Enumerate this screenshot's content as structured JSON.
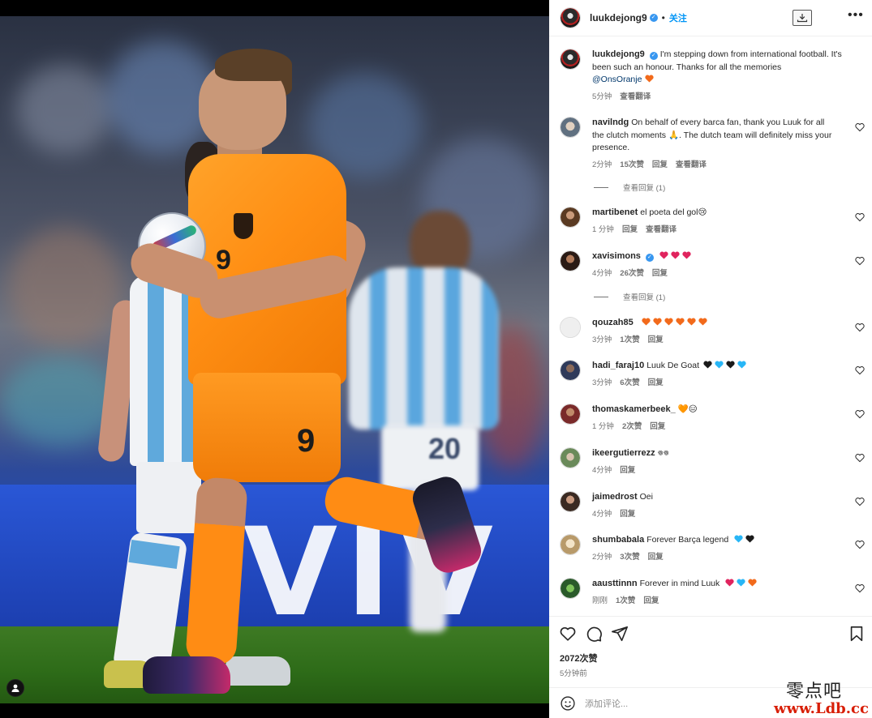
{
  "post": {
    "author": "luukdejong9",
    "follow_label": "关注",
    "dot": "•",
    "caption": "I'm stepping down from international football. It's been such an honour. Thanks for all the memories",
    "caption_mention": "@OnsOranje",
    "caption_time": "5分钟",
    "caption_translate": "查看翻译",
    "likes": "2072次赞",
    "posted": "5分钟前",
    "add_comment_placeholder": "添加评论..."
  },
  "photo": {
    "shirt_number": "9",
    "shorts_number": "9",
    "banner_text": "VIV",
    "bg_number": "20"
  },
  "comments": [
    {
      "user": "navilndg",
      "text": "On behalf of every barca fan, thank you Luuk for all the clutch moments 🙏. The dutch team will definitely miss your presence.",
      "time": "2分钟",
      "likes": "15次赞",
      "reply": "回复",
      "translate": "查看翻译",
      "view_replies": "查看回复 (1)"
    },
    {
      "user": "martibenet",
      "text": "el poeta del gol😢",
      "time": "1 分钟",
      "reply": "回复",
      "translate": "查看翻译"
    },
    {
      "user": "xavisimons",
      "text": "",
      "time": "4分钟",
      "likes": "26次赞",
      "reply": "回复",
      "view_replies": "查看回复 (1)"
    },
    {
      "user": "qouzah85",
      "text": "",
      "time": "3分钟",
      "likes": "1次赞",
      "reply": "回复"
    },
    {
      "user": "hadi_faraj10",
      "text": "Luuk De Goat",
      "time": "3分钟",
      "likes": "6次赞",
      "reply": "回复"
    },
    {
      "user": "thomaskamerbeek_",
      "text": "🧡😑",
      "time": "1 分钟",
      "likes": "2次赞",
      "reply": "回复"
    },
    {
      "user": "ikeergutierrezz",
      "text": "𖦹𖦹",
      "time": "4分钟",
      "reply": "回复"
    },
    {
      "user": "jaimedrost",
      "text": "Oei",
      "time": "4分钟",
      "reply": "回复"
    },
    {
      "user": "shumbabala",
      "text": "Forever Barça legend",
      "time": "2分钟",
      "likes": "3次赞",
      "reply": "回复"
    },
    {
      "user": "aausttinnn",
      "text": "Forever in mind Luuk",
      "time": "刚刚",
      "likes": "1次赞",
      "reply": "回复"
    }
  ],
  "watermark": {
    "line1": "零点吧",
    "line2": "www.Ldb.cc"
  },
  "icons": {
    "verified": "verified-badge-icon",
    "download": "download-icon",
    "more": "more-options-icon",
    "like": "heart-icon",
    "comment": "comment-icon",
    "share": "send-icon",
    "save": "bookmark-icon",
    "emoji": "emoji-icon"
  },
  "colors": {
    "accent": "#0095f6",
    "orange_heart": "#f26a1b",
    "red_heart": "#e0245e",
    "blue_heart": "#28b6f6"
  }
}
